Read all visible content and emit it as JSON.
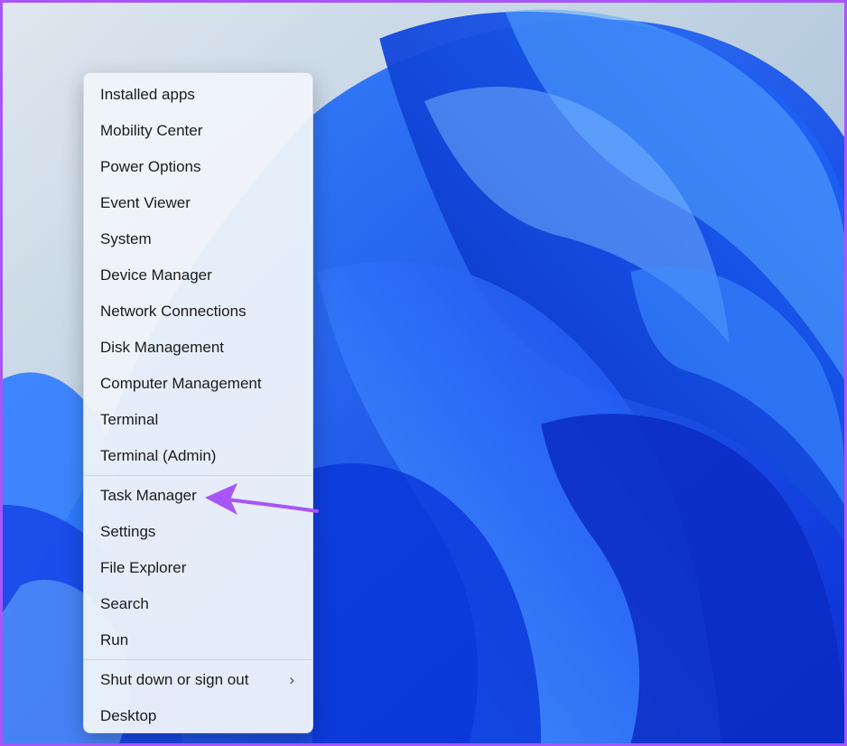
{
  "menu": {
    "group1": [
      {
        "label": "Installed apps"
      },
      {
        "label": "Mobility Center"
      },
      {
        "label": "Power Options"
      },
      {
        "label": "Event Viewer"
      },
      {
        "label": "System"
      },
      {
        "label": "Device Manager"
      },
      {
        "label": "Network Connections"
      },
      {
        "label": "Disk Management"
      },
      {
        "label": "Computer Management"
      },
      {
        "label": "Terminal"
      },
      {
        "label": "Terminal (Admin)"
      }
    ],
    "group2": [
      {
        "label": "Task Manager"
      },
      {
        "label": "Settings"
      },
      {
        "label": "File Explorer"
      },
      {
        "label": "Search"
      },
      {
        "label": "Run"
      }
    ],
    "group3": [
      {
        "label": "Shut down or sign out",
        "chevron": "›"
      },
      {
        "label": "Desktop"
      }
    ]
  },
  "annotation": {
    "arrow_color": "#a855f7",
    "target": "Task Manager"
  },
  "colors": {
    "frame_border": "#a855f7",
    "wallpaper_blue": "#1a5cff"
  }
}
